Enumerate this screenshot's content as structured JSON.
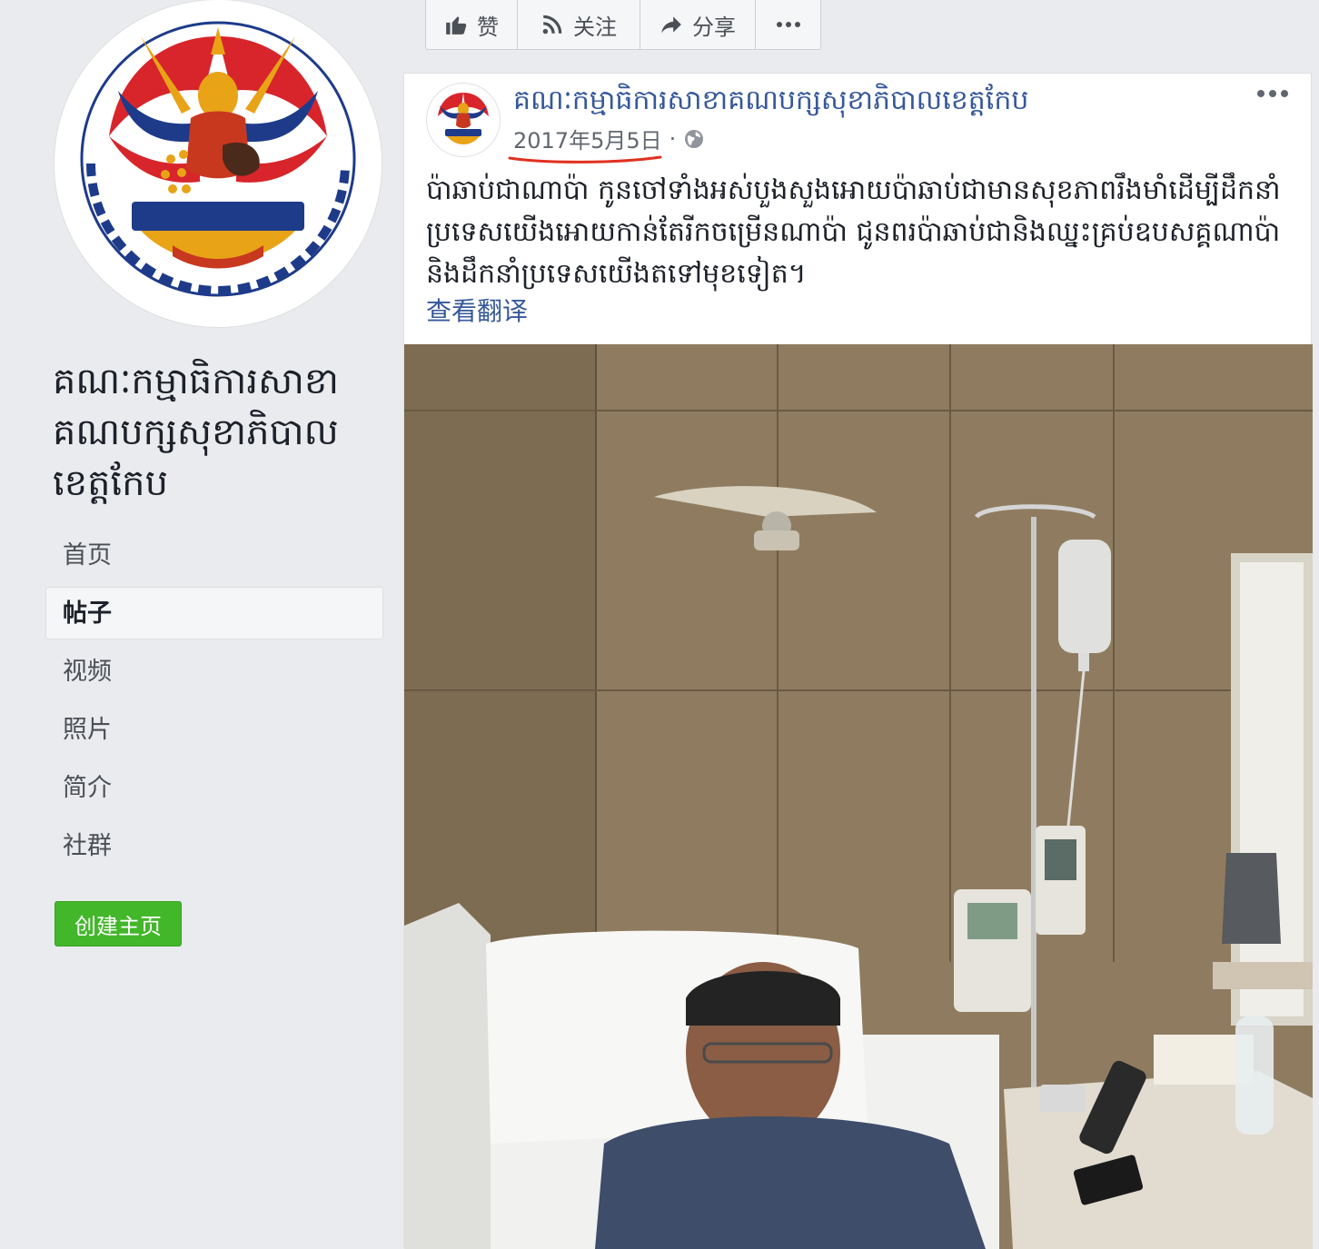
{
  "page": {
    "name": "គណៈកម្មាធិការសាខាគណបក្សសុខាភិបាលខេត្តកែប"
  },
  "nav": {
    "items": [
      "首页",
      "帖子",
      "视频",
      "照片",
      "简介",
      "社群"
    ],
    "active": "帖子",
    "create_page_label": "创建主页"
  },
  "action_bar": {
    "like": "赞",
    "follow": "关注",
    "share": "分享"
  },
  "post": {
    "author": "គណៈកម្មាធិការសាខាគណបក្សសុខាភិបាលខេត្តកែប",
    "date": "2017年5月5日",
    "separator": "·",
    "audience_icon": "globe-icon",
    "text": "ប៉ាឆាប់ជាណាប៉ា កូនចៅទាំងអស់បួងសួងអោយប៉ាឆាប់ជាមានសុខភាពរឹងមាំដើម្បីដឹកនាំប្រទេសយើងអោយកាន់តែរីកចម្រើនណាប៉ា ជូនពរប៉ាឆាប់ជានិងឈ្នះគ្រប់ឧបសគ្គណាប៉ា និងដឹកនាំប្រទេសយើងតទៅមុខទៀត។",
    "translate_label": "查看翻译"
  },
  "colors": {
    "link": "#365899",
    "create_button": "#42b72a",
    "date_underline": "#e0311f",
    "page_background": "#e9ebee"
  }
}
